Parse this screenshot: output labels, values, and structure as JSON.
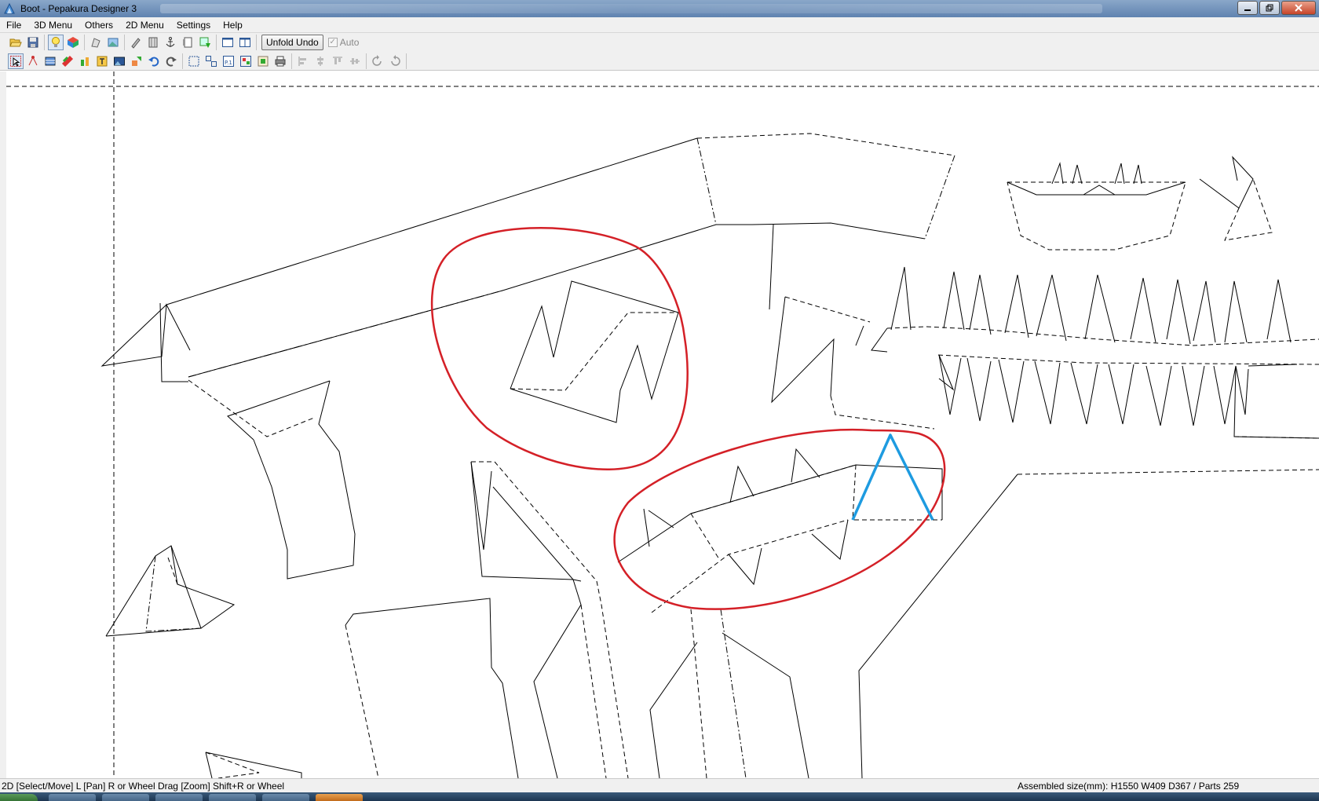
{
  "window": {
    "title": "Boot - Pepakura Designer 3",
    "controls": [
      "minimize",
      "maximize",
      "close"
    ]
  },
  "menu": [
    "File",
    "3D Menu",
    "Others",
    "2D Menu",
    "Settings",
    "Help"
  ],
  "toolbar1": {
    "unfold_undo_label": "Unfold Undo",
    "auto_label": "Auto",
    "auto_checked": true,
    "auto_enabled": false,
    "icons": [
      "open-icon",
      "save-icon",
      "lightbulb-icon",
      "cube-color-icon",
      "model-view-icon",
      "texture-icon",
      "pen-icon",
      "ruler-icon",
      "anchor-icon",
      "paper-icon",
      "edit-part-icon",
      "single-pane-icon",
      "dual-pane-icon"
    ]
  },
  "toolbar2": {
    "icons": [
      "select-move-icon",
      "join-edge-icon",
      "add-flap-icon",
      "layers-icon",
      "edit-color-icon",
      "text-tool-icon",
      "image-tool-icon",
      "rotate-part-icon",
      "undo-icon",
      "redo-icon",
      "fit-page-icon",
      "arrange-icon",
      "page-number-icon",
      "auto-layout-icon",
      "print-preview-icon",
      "print-icon",
      "align-left-icon",
      "align-center-icon",
      "align-top-icon",
      "align-middle-icon",
      "rotate-90-ccw-icon",
      "rotate-90-cw-icon"
    ]
  },
  "status": {
    "hint": "2D [Select/Move] L [Pan] R or Wheel Drag [Zoom] Shift+R or Wheel",
    "assembled": "Assembled size(mm): H1550 W409 D367 / Parts 259"
  },
  "colors": {
    "annotation_red": "#d42027",
    "annotation_blue": "#1e9be0",
    "line": "#000000"
  }
}
